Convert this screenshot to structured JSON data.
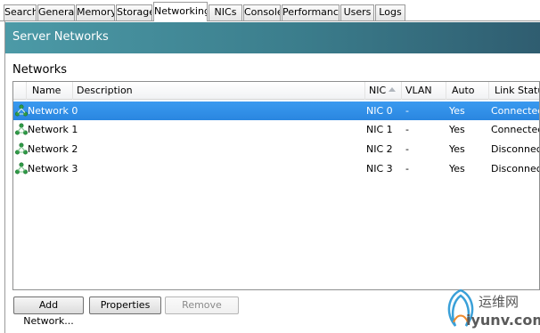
{
  "tabs": [
    {
      "label": "Search",
      "active": false
    },
    {
      "label": "General",
      "active": false
    },
    {
      "label": "Memory",
      "active": false
    },
    {
      "label": "Storage",
      "active": false
    },
    {
      "label": "Networking",
      "active": true
    },
    {
      "label": "NICs",
      "active": false
    },
    {
      "label": "Console",
      "active": false
    },
    {
      "label": "Performance",
      "active": false
    },
    {
      "label": "Users",
      "active": false
    },
    {
      "label": "Logs",
      "active": false
    }
  ],
  "banner": {
    "title": "Server Networks"
  },
  "section": {
    "title": "Networks"
  },
  "table": {
    "columns": [
      "Name",
      "Description",
      "NIC",
      "VLAN",
      "Auto",
      "Link Status"
    ],
    "sorted_column": "NIC",
    "rows": [
      {
        "name": "Network 0",
        "description": "",
        "nic": "NIC 0",
        "vlan": "-",
        "auto": "Yes",
        "link_status": "Connected",
        "selected": true
      },
      {
        "name": "Network 1",
        "description": "",
        "nic": "NIC 1",
        "vlan": "-",
        "auto": "Yes",
        "link_status": "Connected",
        "selected": false
      },
      {
        "name": "Network 2",
        "description": "",
        "nic": "NIC 2",
        "vlan": "-",
        "auto": "Yes",
        "link_status": "Disconnected",
        "selected": false
      },
      {
        "name": "Network 3",
        "description": "",
        "nic": "NIC 3",
        "vlan": "-",
        "auto": "Yes",
        "link_status": "Disconnected",
        "selected": false
      }
    ]
  },
  "buttons": {
    "add_network": "Add Network...",
    "properties": "Properties",
    "remove": "Remove"
  },
  "watermark": {
    "top_text": "运维网",
    "bottom_text": "iyunv.com"
  },
  "colors": {
    "banner_start": "#4c9aa7",
    "banner_end": "#2f5d70",
    "selection": "#3399ee",
    "network_icon": "#2e9b46"
  }
}
